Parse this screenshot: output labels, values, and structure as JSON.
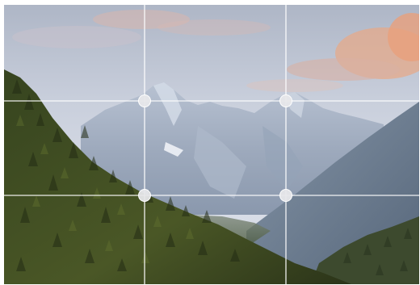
{
  "editor": {
    "image": "mountain-valley-photo",
    "overlay": "rule-of-thirds-grid",
    "grid": {
      "rows": 3,
      "columns": 3
    },
    "handles": [
      "intersection-top-left",
      "intersection-top-right",
      "intersection-bottom-left",
      "intersection-bottom-right"
    ],
    "colors": {
      "grid_line": "#ffffff",
      "handle": "#e7e7ea",
      "sky": "#cfd6e2",
      "cloud": "#e9b49c",
      "mountain": "#9fb0c6",
      "forest": "#2f3a1e"
    }
  }
}
